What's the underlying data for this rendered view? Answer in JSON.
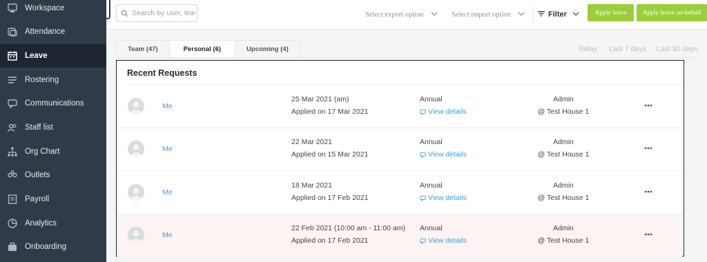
{
  "sidebar": {
    "items": [
      {
        "label": "Workspace",
        "icon": "workspace-icon"
      },
      {
        "label": "Attendance",
        "icon": "attendance-icon"
      },
      {
        "label": "Leave",
        "icon": "calendar-icon",
        "active": true
      },
      {
        "label": "Rostering",
        "icon": "rostering-icon"
      },
      {
        "label": "Communications",
        "icon": "chat-icon"
      },
      {
        "label": "Staff list",
        "icon": "people-icon"
      },
      {
        "label": "Org Chart",
        "icon": "org-chart-icon"
      },
      {
        "label": "Outlets",
        "icon": "outlets-icon"
      },
      {
        "label": "Payroll",
        "icon": "payroll-icon"
      },
      {
        "label": "Analytics",
        "icon": "analytics-icon"
      },
      {
        "label": "Onboarding",
        "icon": "briefcase-icon"
      }
    ]
  },
  "toolbar": {
    "search_placeholder": "Search by user, leave",
    "export_label": "Select export option",
    "import_label": "Select import option",
    "filter_label": "Filter",
    "apply_leave_label": "Apply leave",
    "apply_leave_behalf_label": "Apply leave on-behalf"
  },
  "tabs": [
    {
      "label": "Team (47)"
    },
    {
      "label": "Personal (6)",
      "active": true
    },
    {
      "label": "Upcoming (4)"
    }
  ],
  "ranges": {
    "today": "Today",
    "last7": "Last 7 days",
    "last30": "Last 30 days"
  },
  "card": {
    "title": "Recent Requests",
    "rows": [
      {
        "who": "Me",
        "date": "25 Mar 2021 (am)",
        "applied": "Applied on 17 Mar 2021",
        "type": "Annual",
        "view": "View details",
        "role": "Admin",
        "location": "@ Test House 1"
      },
      {
        "who": "Me",
        "date": "22 Mar 2021",
        "applied": "Applied on 15 Mar 2021",
        "type": "Annual",
        "view": "View details",
        "role": "Admin",
        "location": "@ Test House 1"
      },
      {
        "who": "Me",
        "date": "18 Mar 2021",
        "applied": "Applied on 17 Feb 2021",
        "type": "Annual",
        "view": "View details",
        "role": "Admin",
        "location": "@ Test House 1"
      },
      {
        "who": "Me",
        "date": "22 Feb 2021 (10:00 am - 11:00 am)",
        "applied": "Applied on 17 Feb 2021",
        "type": "Annual",
        "view": "View details",
        "role": "Admin",
        "location": "@ Test House 1"
      }
    ]
  },
  "colors": {
    "sidebar_bg": "#2f3b47",
    "sidebar_active": "#1e2731",
    "accent_green": "#9ccd3a",
    "link_blue": "#3d9ed6",
    "highlight_row": "#fdf3f3"
  }
}
